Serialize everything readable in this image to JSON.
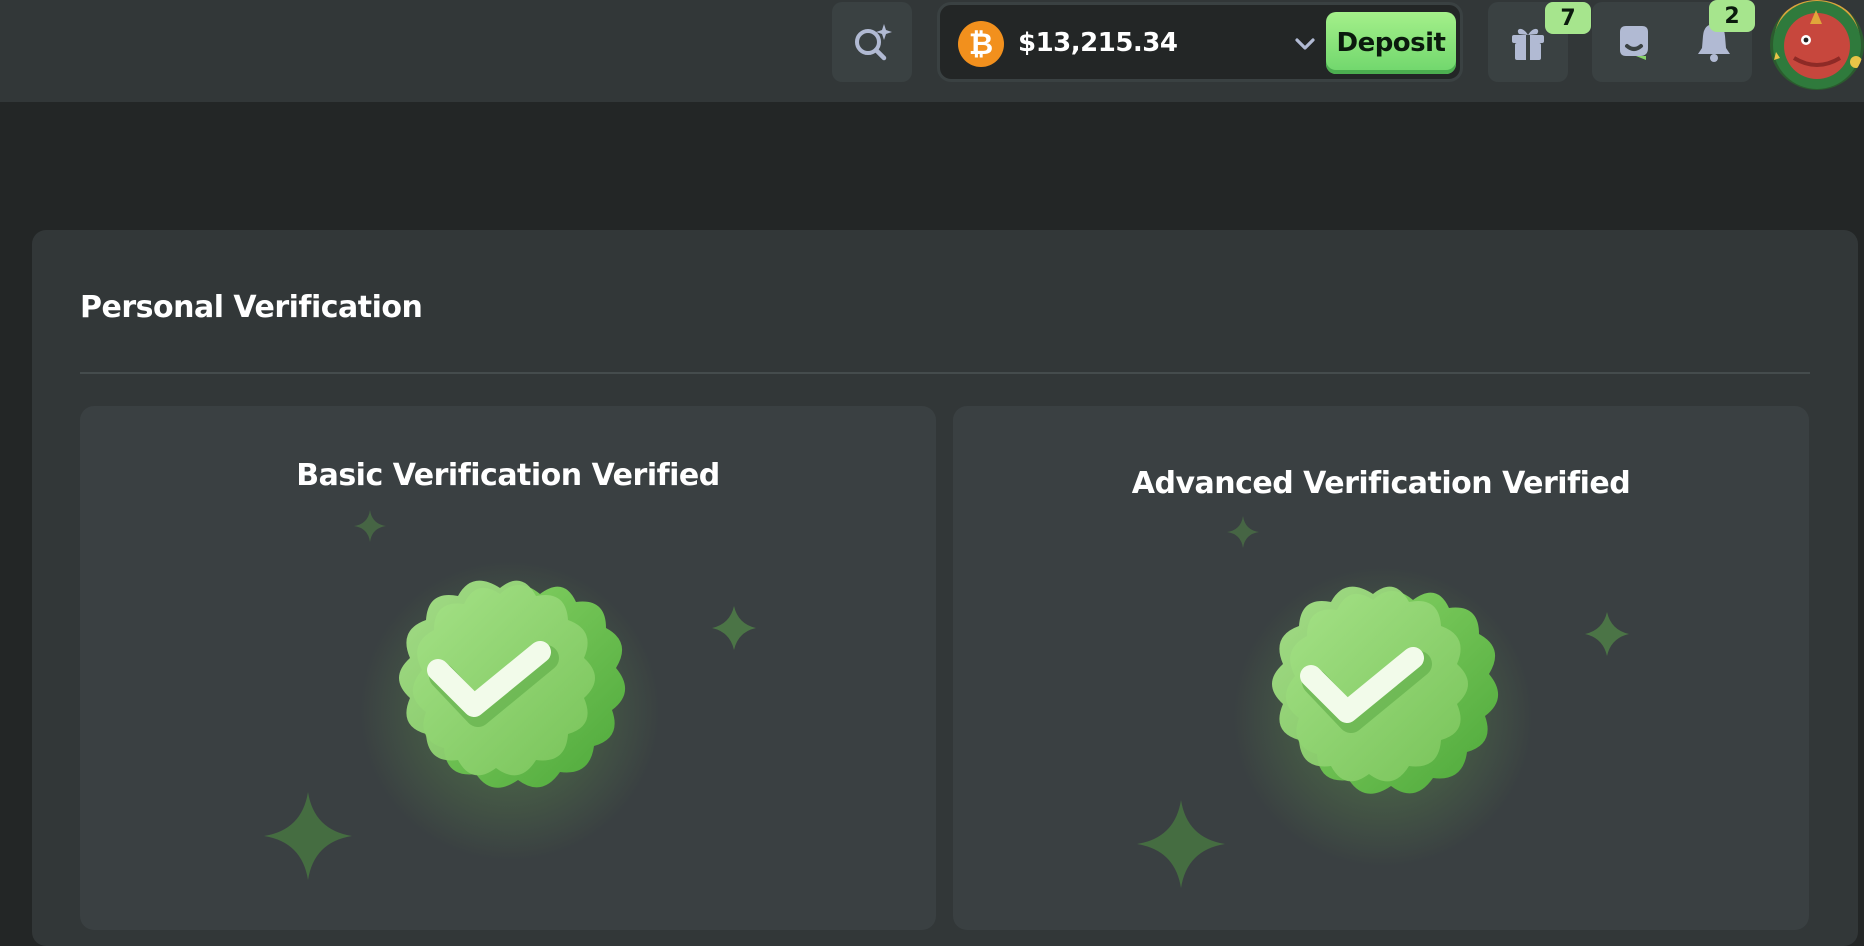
{
  "header": {
    "wallet": {
      "currency_icon": "bitcoin-icon",
      "balance": "$13,215.34",
      "deposit_label": "Deposit"
    },
    "gift_count": "7",
    "notification_count": "2",
    "icons": [
      "search-sparkle-icon",
      "chevron-down-icon",
      "gift-icon",
      "chat-icon",
      "bell-icon"
    ]
  },
  "main": {
    "title": "Personal Verification",
    "cards": [
      {
        "label": "Basic Verification Verified",
        "status": "verified"
      },
      {
        "label": "Advanced Verification Verified",
        "status": "verified"
      }
    ]
  },
  "colors": {
    "background": "#232626",
    "header": "#323738",
    "panel": "#323738",
    "card": "#3a4042",
    "accent_green": "#86d26a",
    "deposit": "#8ee47e",
    "bitcoin": "#f2901d"
  }
}
